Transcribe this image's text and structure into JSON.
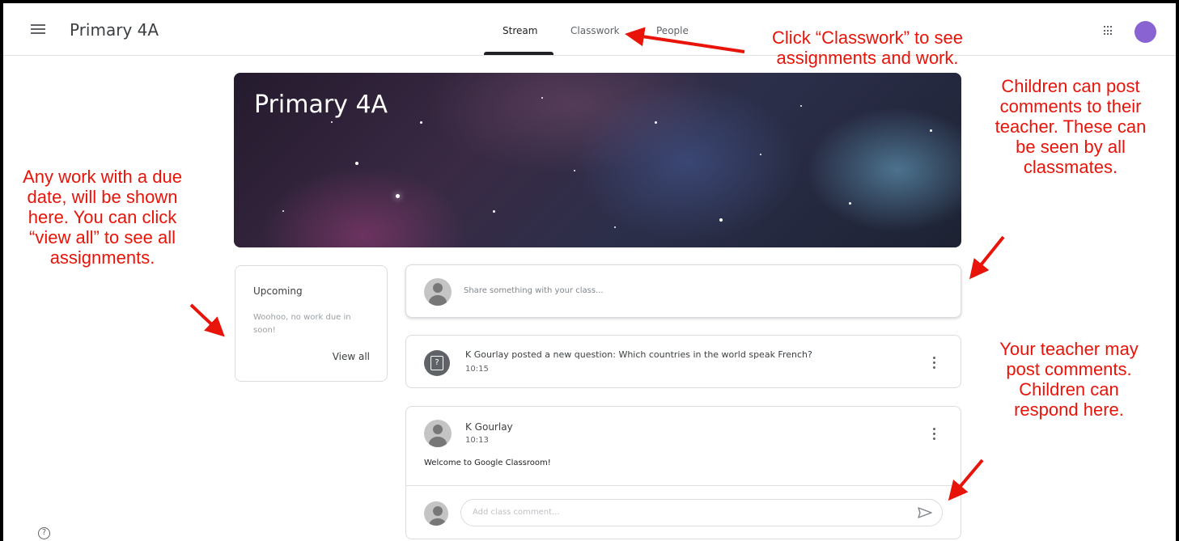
{
  "header": {
    "class_title": "Primary 4A",
    "tabs": [
      {
        "label": "Stream",
        "active": true
      },
      {
        "label": "Classwork",
        "active": false
      },
      {
        "label": "People",
        "active": false
      }
    ],
    "icons": [
      "menu-icon",
      "apps-grid-icon"
    ],
    "avatar_color": "#8a63d2"
  },
  "banner": {
    "title": "Primary 4A"
  },
  "upcoming": {
    "title": "Upcoming",
    "message": "Woohoo, no work due in soon!",
    "view_all": "View all"
  },
  "share_box": {
    "placeholder": "Share something with your class..."
  },
  "stream": [
    {
      "type": "question",
      "title": "K Gourlay posted a new question: Which countries in the world speak French?",
      "time": "10:15",
      "icon": "question-icon"
    },
    {
      "type": "announcement",
      "author": "K Gourlay",
      "time": "10:13",
      "body": "Welcome to Google Classroom!",
      "comment_placeholder": "Add class comment..."
    }
  ],
  "annotations": {
    "classwork": "Click “Classwork” to see assignments and work.",
    "due_work": "Any work with a due date, will be shown here. You can click “view all” to see all assignments.",
    "comments": "Children can post comments to their teacher. These can be seen by all classmates.",
    "teacher": "Your teacher may post comments. Children can respond here."
  },
  "colors": {
    "annotation": "#e8140a",
    "tab_active": "#202124"
  }
}
